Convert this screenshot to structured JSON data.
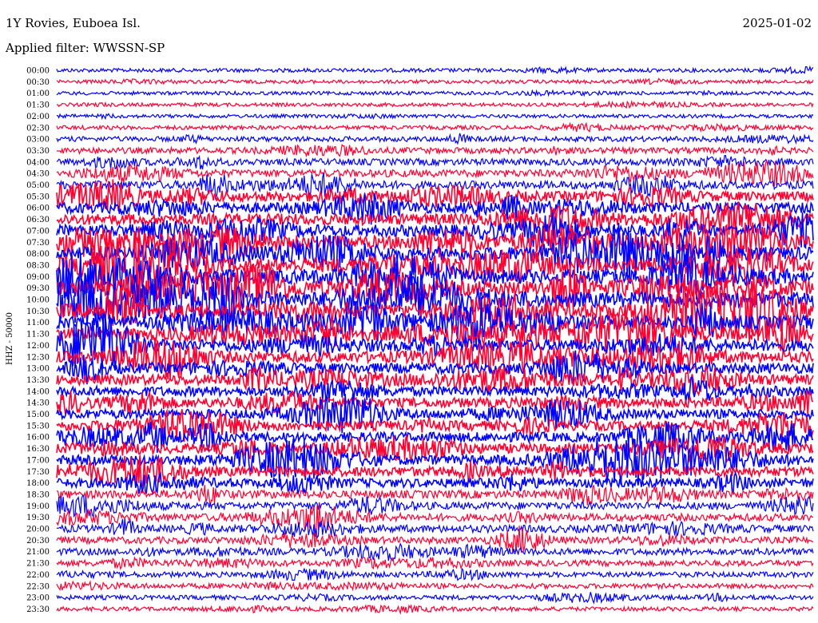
{
  "header": {
    "station": "1Y Rovies, Euboea Isl.",
    "date": "2025-01-02",
    "filter": "Applied filter: WWSSN-SP"
  },
  "chart_data": {
    "type": "line",
    "title": "1Y Rovies, Euboea Isl.",
    "date": "2025-01-02",
    "filter": "WWSSN-SP",
    "ylabel": "HHZ - 50000",
    "row_labels": [
      "00:00",
      "00:30",
      "01:00",
      "01:30",
      "02:00",
      "02:30",
      "03:00",
      "03:30",
      "04:00",
      "04:30",
      "05:00",
      "05:30",
      "06:00",
      "06:30",
      "07:00",
      "07:30",
      "08:00",
      "08:30",
      "09:00",
      "09:30",
      "10:00",
      "10:30",
      "11:00",
      "11:30",
      "12:00",
      "12:30",
      "13:00",
      "13:30",
      "14:00",
      "14:30",
      "15:00",
      "15:30",
      "16:00",
      "16:30",
      "17:00",
      "17:30",
      "18:00",
      "18:30",
      "19:00",
      "19:30",
      "20:00",
      "20:30",
      "21:00",
      "21:30",
      "22:00",
      "22:30",
      "23:00",
      "23:30"
    ],
    "row_colors": [
      "#0000ff",
      "#ff0033"
    ],
    "activity_levels": [
      0.1,
      0.08,
      0.08,
      0.08,
      0.08,
      0.12,
      0.18,
      0.25,
      0.3,
      0.35,
      0.4,
      0.5,
      0.55,
      0.6,
      0.65,
      0.7,
      0.75,
      0.8,
      0.8,
      0.85,
      0.9,
      0.85,
      0.8,
      0.7,
      0.65,
      0.6,
      0.55,
      0.55,
      0.5,
      0.5,
      0.5,
      0.5,
      0.5,
      0.5,
      0.5,
      0.5,
      0.45,
      0.4,
      0.35,
      0.35,
      0.35,
      0.3,
      0.3,
      0.25,
      0.2,
      0.18,
      0.15,
      0.12
    ],
    "grid": false,
    "legend": "none"
  }
}
